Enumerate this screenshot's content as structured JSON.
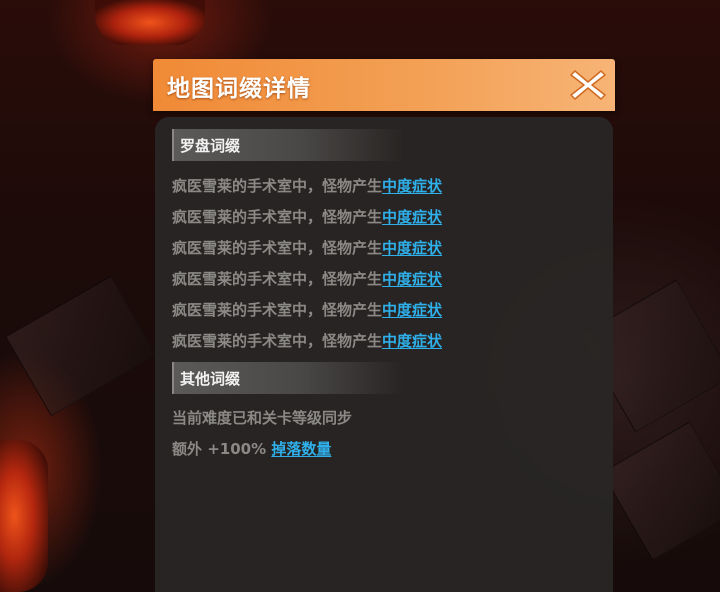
{
  "dialog": {
    "title": "地图词缀详情",
    "close_icon": "close-x-icon"
  },
  "sections": {
    "compass": {
      "title": "罗盘词缀",
      "affixes": [
        {
          "text": "疯医雪莱的手术室中，怪物产生",
          "link": "中度症状"
        },
        {
          "text": "疯医雪莱的手术室中，怪物产生",
          "link": "中度症状"
        },
        {
          "text": "疯医雪莱的手术室中，怪物产生",
          "link": "中度症状"
        },
        {
          "text": "疯医雪莱的手术室中，怪物产生",
          "link": "中度症状"
        },
        {
          "text": "疯医雪莱的手术室中，怪物产生",
          "link": "中度症状"
        },
        {
          "text": "疯医雪莱的手术室中，怪物产生",
          "link": "中度症状"
        }
      ]
    },
    "other": {
      "title": "其他词缀",
      "line1": "当前难度已和关卡等级同步",
      "line2_text": "额外 +100% ",
      "line2_link": "掉落数量"
    }
  },
  "colors": {
    "header_orange": "#f08a36",
    "link_blue": "#2fb0ea",
    "text_gray": "#8b8986"
  }
}
